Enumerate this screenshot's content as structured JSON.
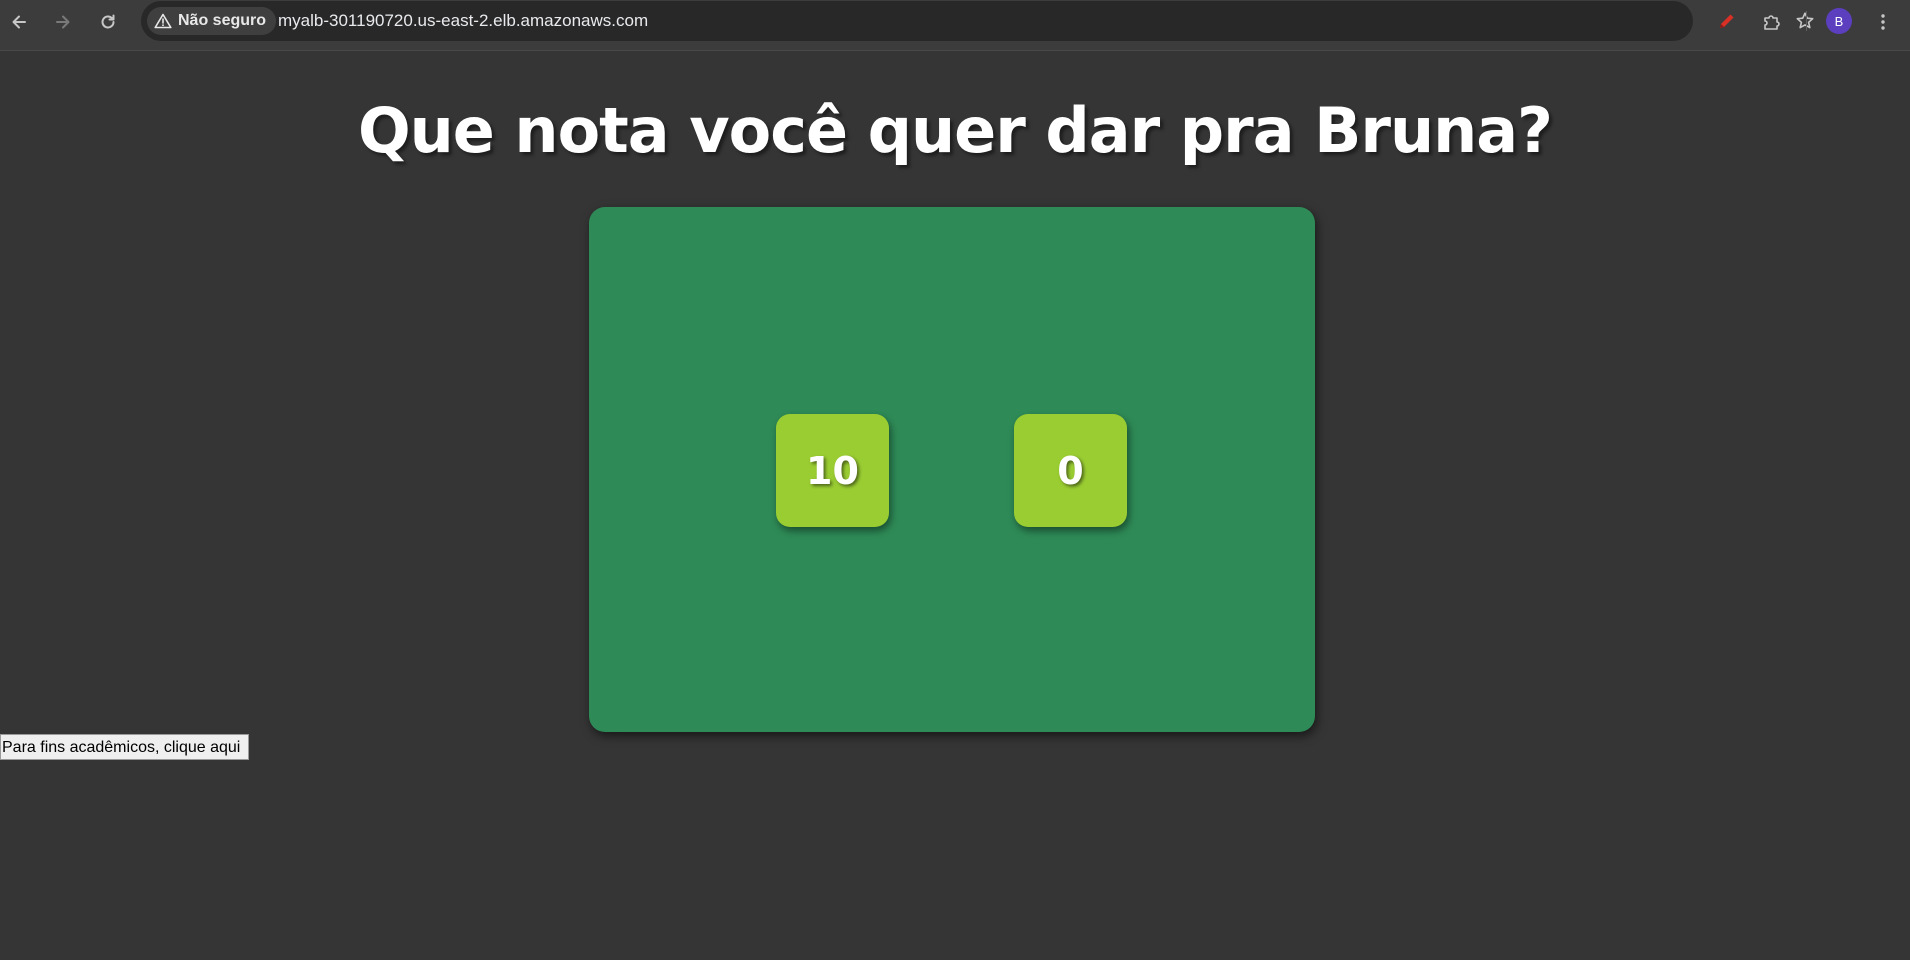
{
  "browser": {
    "security_label": "Não seguro",
    "url": "myalb-301190720.us-east-2.elb.amazonaws.com",
    "profile_initial": "B",
    "icons": {
      "back": "arrow-left-icon",
      "forward": "arrow-right-icon",
      "reload": "reload-icon",
      "security": "warning-triangle-icon",
      "bookmark": "star-icon",
      "extension_pen": "pen-icon",
      "extensions": "puzzle-icon",
      "menu": "kebab-menu-icon"
    }
  },
  "page": {
    "title": "Que nota você quer dar pra Bruna?",
    "grade_options": [
      "10",
      "0"
    ],
    "academic_link": "Para fins acadêmicos, clique aqui"
  },
  "colors": {
    "page_background": "#353535",
    "card_background": "#2e8b57",
    "button_background": "#9acd32",
    "title_text": "#ffffff"
  }
}
